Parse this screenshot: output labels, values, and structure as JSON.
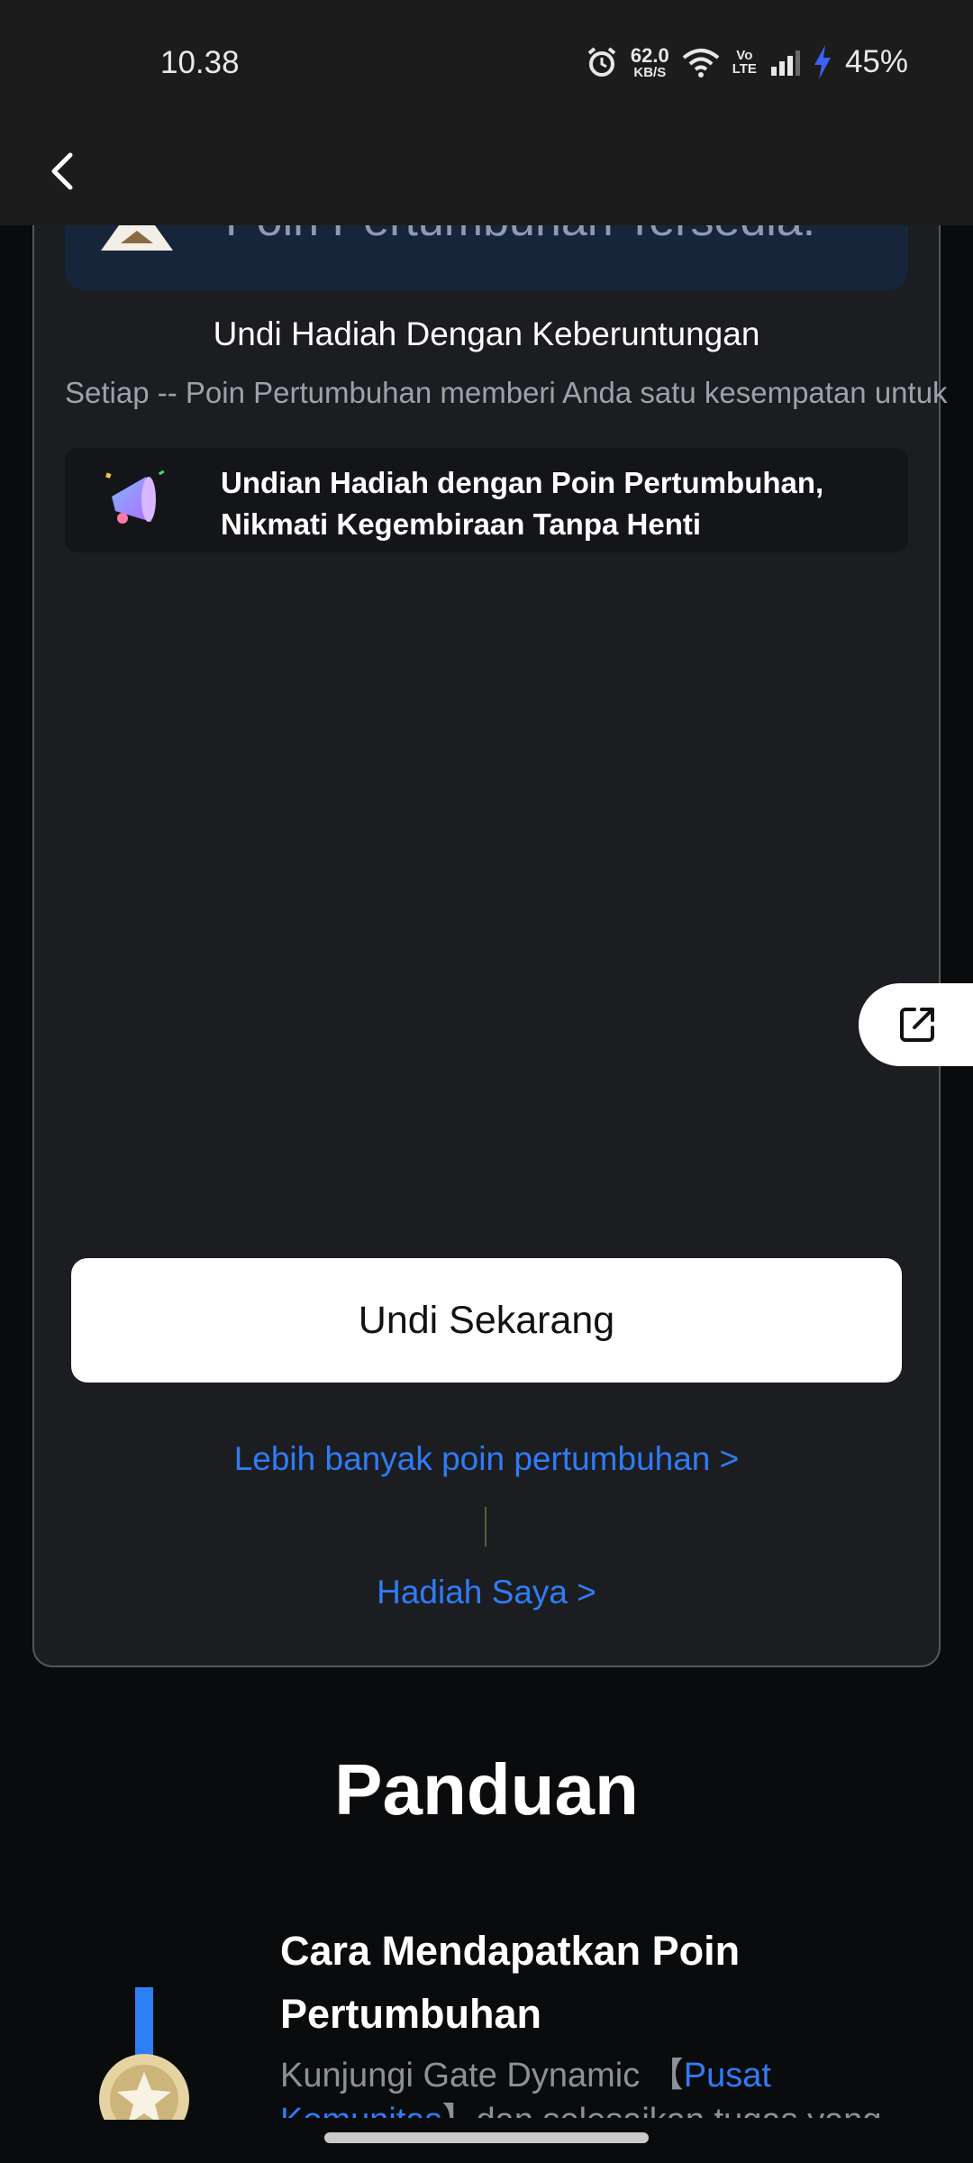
{
  "status_bar": {
    "time": "10.38",
    "net_speed_value": "62.0",
    "net_speed_unit": "KB/S",
    "volte_top": "Vo",
    "volte_bottom": "LTE",
    "battery": "45%",
    "icons": [
      "alarm-icon",
      "wifi-icon",
      "signal-icon",
      "charging-icon"
    ]
  },
  "header": {
    "back_icon": "chevron-left-icon"
  },
  "draw_card": {
    "available_points_text": "Poin Pertumbuhan Tersedia: --",
    "lucky_title": "Undi Hadiah Dengan Keberuntungan",
    "lucky_description": "Setiap -- Poin Pertumbuhan memberi Anda satu kesempatan untuk",
    "promo_text": "Undian Hadiah dengan Poin Pertumbuhan, Nikmati Kegembiraan Tanpa Henti",
    "promo_icon": "megaphone-icon",
    "draw_button_label": "Undi Sekarang",
    "more_points_link": "Lebih banyak poin pertumbuhan  >",
    "my_prizes_link": "Hadiah Saya  >"
  },
  "share_button": {
    "icon": "share-external-icon"
  },
  "guide": {
    "title": "Panduan",
    "items": [
      {
        "icon": "medal-icon",
        "title": "Cara Mendapatkan Poin Pertumbuhan",
        "desc_before": "Kunjungi Gate Dynamic 【",
        "desc_highlight": "Pusat Komunitas",
        "desc_after": "】dan selesaikan tugas yang"
      }
    ]
  },
  "colors": {
    "background": "#0a0b0d",
    "card": "#1c1d21",
    "accent_link": "#2f7cf6",
    "banner": "#16253a",
    "button": "#ffffff"
  }
}
